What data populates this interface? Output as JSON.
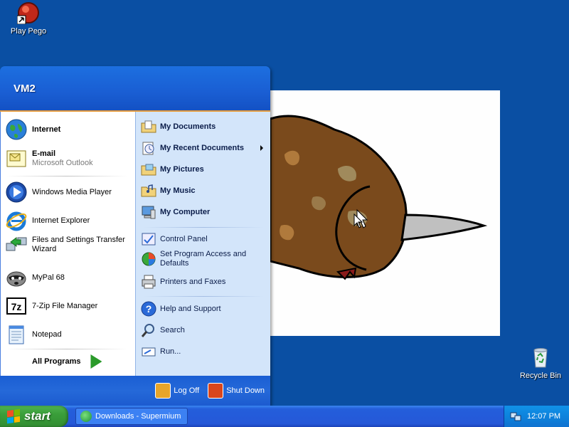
{
  "desktop": {
    "icons": [
      {
        "label": "Play Pego",
        "icon": "pego-icon"
      },
      {
        "label": "Recycle Bin",
        "icon": "recycle-bin-icon"
      }
    ]
  },
  "start_menu": {
    "user_name": "VM2",
    "left": {
      "pinned": [
        {
          "label": "Internet",
          "icon": "globe-icon"
        },
        {
          "label": "E-mail",
          "sub": "Microsoft Outlook",
          "icon": "outlook-icon"
        }
      ],
      "recent": [
        {
          "label": "Windows Media Player",
          "icon": "media-player-icon"
        },
        {
          "label": "Internet Explorer",
          "icon": "ie-icon"
        },
        {
          "label": "Files and Settings Transfer Wizard",
          "icon": "transfer-wizard-icon"
        },
        {
          "label": "MyPal 68",
          "icon": "mypal-icon"
        },
        {
          "label": "7-Zip File Manager",
          "icon": "7zip-icon"
        },
        {
          "label": "Notepad",
          "icon": "notepad-icon"
        }
      ],
      "all_programs": "All Programs"
    },
    "right": {
      "group1": [
        {
          "label": "My Documents",
          "icon": "folder-documents-icon"
        },
        {
          "label": "My Recent Documents",
          "icon": "recent-documents-icon"
        },
        {
          "label": "My Pictures",
          "icon": "folder-pictures-icon"
        },
        {
          "label": "My Music",
          "icon": "folder-music-icon"
        },
        {
          "label": "My Computer",
          "icon": "computer-icon"
        }
      ],
      "group2": [
        {
          "label": "Control Panel",
          "icon": "control-panel-icon"
        },
        {
          "label": "Set Program Access and Defaults",
          "icon": "program-access-icon"
        },
        {
          "label": "Printers and Faxes",
          "icon": "printer-icon"
        }
      ],
      "group3": [
        {
          "label": "Help and Support",
          "icon": "help-icon"
        },
        {
          "label": "Search",
          "icon": "search-icon"
        },
        {
          "label": "Run...",
          "icon": "run-icon"
        }
      ]
    },
    "footer": {
      "log_off": "Log Off",
      "shut_down": "Shut Down"
    }
  },
  "taskbar": {
    "start_label": "start",
    "tasks": [
      {
        "label": "Downloads - Supermium",
        "icon": "supermium-icon"
      }
    ],
    "clock": "12:07 PM"
  },
  "colors": {
    "desktop": "#0a4fa3",
    "menu_header": "#1a5ed3",
    "menu_right": "#d3e5fa",
    "start_button": "#3a9e3a"
  }
}
